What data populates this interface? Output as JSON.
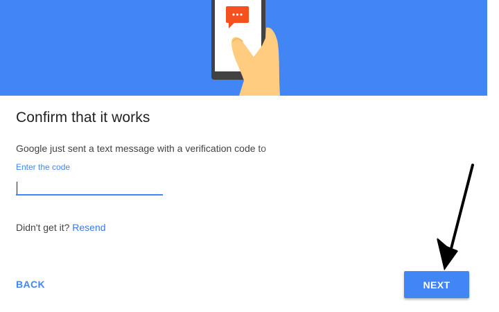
{
  "header": {
    "illustration": "phone-with-chat-bubble-illustration"
  },
  "main": {
    "title": "Confirm that it works",
    "description": "Google just sent a text message with a verification code to",
    "code_label": "Enter the code",
    "code_value": "",
    "resend_prompt": "Didn't get it?",
    "resend_link": "Resend"
  },
  "footer": {
    "back_label": "BACK",
    "next_label": "NEXT"
  },
  "annotation": {
    "arrow": "black-arrow-pointing-to-next"
  },
  "colors": {
    "brand_blue": "#4285f4",
    "hero_bg": "#4285f4",
    "bubble": "#f4511e",
    "skin": "#ffcc80"
  }
}
